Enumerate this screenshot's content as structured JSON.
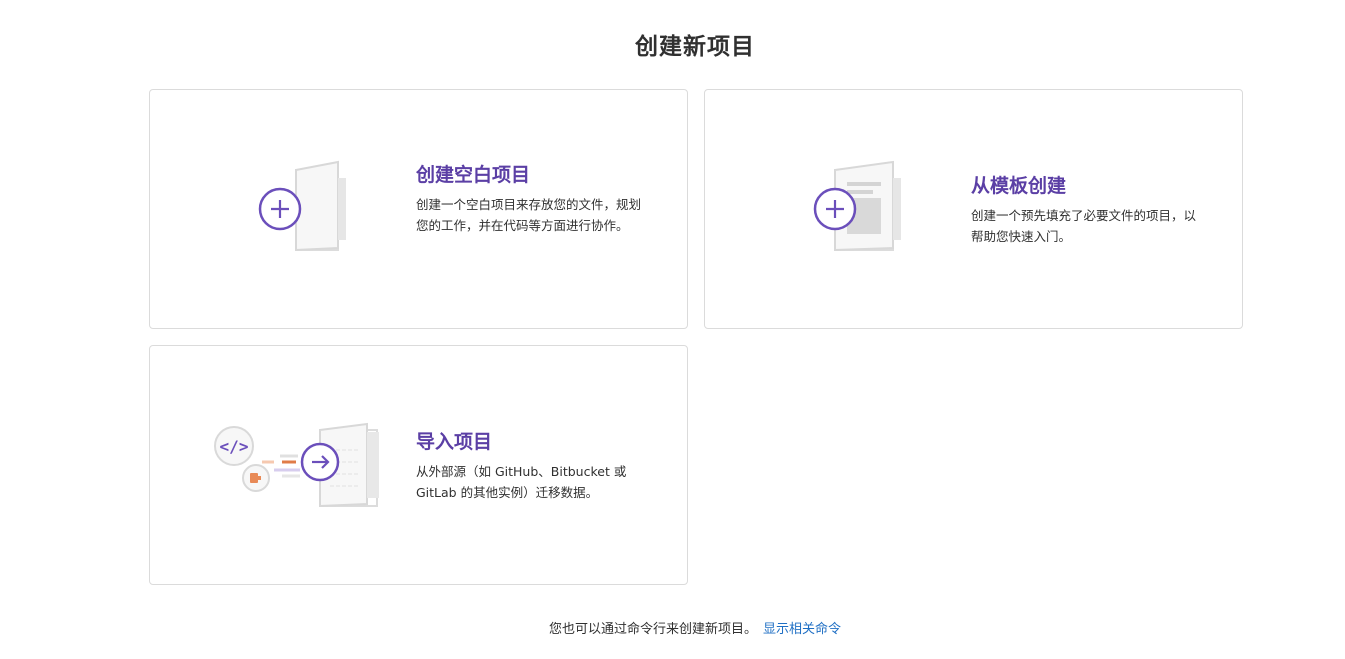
{
  "page": {
    "title": "创建新项目"
  },
  "cards": [
    {
      "title": "创建空白项目",
      "description": "创建一个空白项目来存放您的文件，规划您的工作，并在代码等方面进行协作。",
      "icon": "blank-project-icon"
    },
    {
      "title": "从模板创建",
      "description": "创建一个预先填充了必要文件的项目，以帮助您快速入门。",
      "icon": "template-project-icon"
    },
    {
      "title": "导入项目",
      "description": "从外部源（如 GitHub、Bitbucket 或 GitLab 的其他实例）迁移数据。",
      "icon": "import-project-icon"
    }
  ],
  "footer": {
    "text": "您也可以通过命令行来创建新项目。",
    "link_label": "显示相关命令"
  },
  "colors": {
    "accent": "#5b3fa5",
    "icon_circle": "#6b4fbb",
    "link": "#1f6fc4",
    "border": "#dbdbdb"
  }
}
